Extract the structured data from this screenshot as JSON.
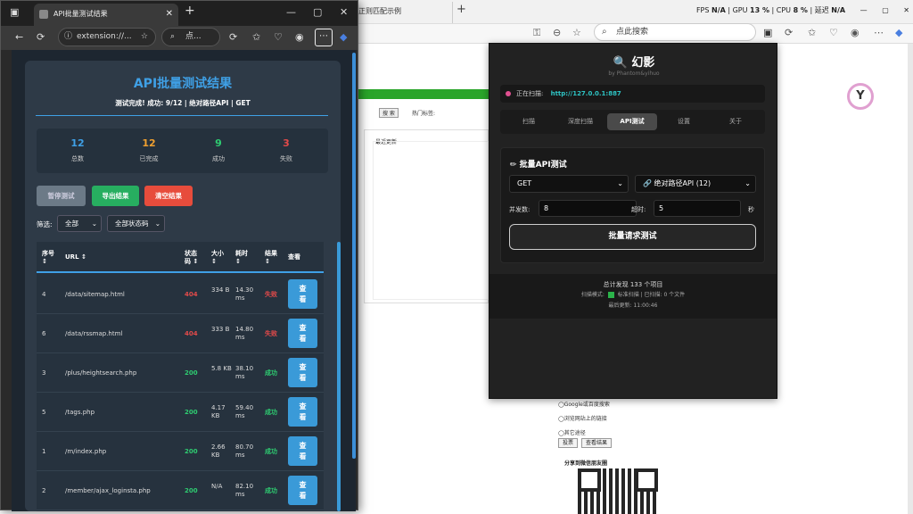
{
  "bg_browser": {
    "tab_title": "正则匹配示例",
    "search_placeholder": "点此搜索",
    "sys": {
      "fps_label": "FPS",
      "fps": "N/A",
      "gpu_label": "GPU",
      "gpu": "13 %",
      "cpu_label": "CPU",
      "cpu": "8 %",
      "temp_label": "延迟",
      "temp": "N/A"
    },
    "form_button": "搜 索",
    "hot_label": "热门标签:",
    "recent_label": "最近更新",
    "radios": [
      "◯Google或百度搜索",
      "◯浏览网站上的链接",
      "◯其它途径"
    ],
    "buttons": [
      "投票",
      "查看结果"
    ],
    "share_label": "分享到微信朋友圈",
    "logo_letter": "Y"
  },
  "popup": {
    "title": "🔍 幻影",
    "subtitle": "by Phantom&yihuo",
    "scanning_label": "正在扫描:",
    "scanning_url": "http://127.0.0.1:887",
    "tabs": [
      "扫描",
      "深度扫描",
      "API测试",
      "设置",
      "关于"
    ],
    "active_tab": "API测试",
    "card_title": "✏ 批量API测试",
    "method": "GET",
    "api_type": "🔗 绝对路径API (12)",
    "concurrency_label": "并发数:",
    "concurrency": "8",
    "timeout_label": "超时:",
    "timeout": "5",
    "timeout_unit": "秒",
    "run_button": "批量请求测试",
    "footer_total": "总计发现 133 个项目",
    "footer_mode_label": "扫描模式:",
    "footer_mode": "标准扫描 | 已扫描: 0 个文件",
    "footer_updated": "最后更新: 11:00:46"
  },
  "window": {
    "tab_title": "API批量测试结果",
    "url_text": "extension://...",
    "search_text": "点...",
    "more_icon": "⋯"
  },
  "results": {
    "title": "API批量测试结果",
    "summary": "测试完成! 成功: 9/12 | 绝对路径API | GET",
    "stats": [
      {
        "value": "12",
        "label": "总数",
        "color": "#3fa0e6"
      },
      {
        "value": "12",
        "label": "已完成",
        "color": "#f0a030"
      },
      {
        "value": "9",
        "label": "成功",
        "color": "#2ecc71"
      },
      {
        "value": "3",
        "label": "失败",
        "color": "#e24a4a"
      }
    ],
    "buttons": {
      "pause": "暂停测试",
      "export": "导出结果",
      "clear": "清空结果"
    },
    "filter_label": "筛选:",
    "filter_all": "全部",
    "filter_status": "全部状态码",
    "columns": [
      "序号 ↕",
      "URL ↕",
      "状态码 ↕",
      "大小 ↕",
      "耗时 ↕",
      "结果 ↕",
      "查看"
    ],
    "view_label": "查看",
    "rows": [
      {
        "idx": "4",
        "url": "/data/sitemap.html",
        "status": "404",
        "size": "334 B",
        "time": "14.30 ms",
        "result": "失败"
      },
      {
        "idx": "6",
        "url": "/data/rssmap.html",
        "status": "404",
        "size": "333 B",
        "time": "14.80 ms",
        "result": "失败"
      },
      {
        "idx": "3",
        "url": "/plus/heightsearch.php",
        "status": "200",
        "size": "5.8 KB",
        "time": "38.10 ms",
        "result": "成功"
      },
      {
        "idx": "5",
        "url": "/tags.php",
        "status": "200",
        "size": "4.17 KB",
        "time": "59.40 ms",
        "result": "成功"
      },
      {
        "idx": "1",
        "url": "/m/index.php",
        "status": "200",
        "size": "2.66 KB",
        "time": "80.70 ms",
        "result": "成功"
      },
      {
        "idx": "2",
        "url": "/member/ajax_loginsta.php",
        "status": "200",
        "size": "N/A",
        "time": "82.10 ms",
        "result": "成功"
      }
    ]
  }
}
